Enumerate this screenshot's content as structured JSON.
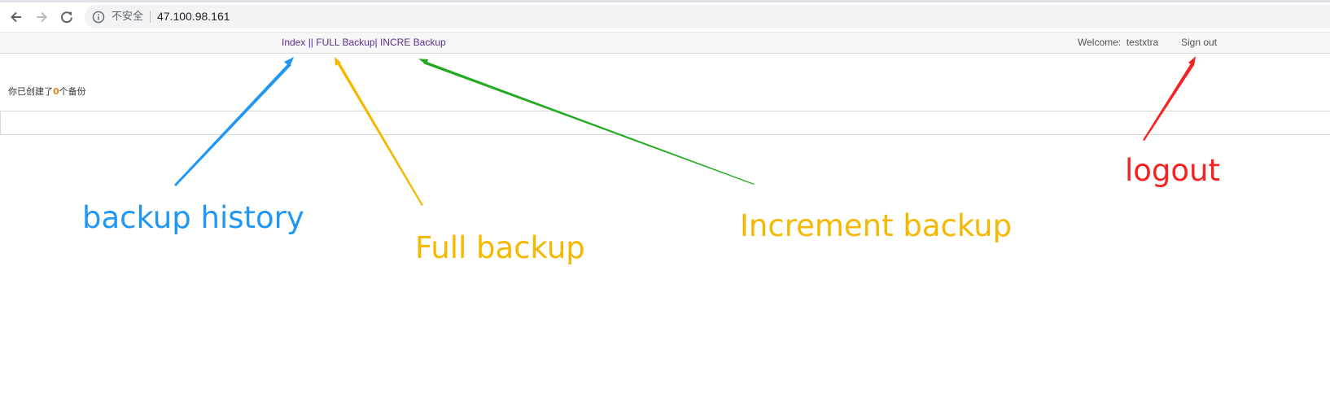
{
  "browser": {
    "security_label": "不安全",
    "url": "47.100.98.161",
    "icons": [
      "back-arrow-icon",
      "forward-arrow-icon",
      "reload-icon",
      "info-icon"
    ]
  },
  "navbar": {
    "links_part1": "Index",
    "links_sep1": " || ",
    "links_part2": "FULL Backup",
    "links_sep2": "| ",
    "links_part3": "INCRE Backup",
    "welcome": "Welcome:  testxtra",
    "signout": "Sign out",
    "link_color": "#5a2f8e"
  },
  "content": {
    "count_prefix": "你已创建了",
    "count_value": "0",
    "count_suffix": "个备份",
    "count_color": "#e8821e"
  },
  "annotations": {
    "backup_history": {
      "text": "backup history",
      "color": "#2196f3"
    },
    "full_backup": {
      "text": "Full backup",
      "color": "#f5b800"
    },
    "increment_backup": {
      "text": "Increment backup",
      "color": "#f5b800"
    },
    "logout": {
      "text": "logout",
      "color": "#f52222"
    },
    "arrow_colors": [
      "#2196f3",
      "#f5b800",
      "#22aa22",
      "#f52222"
    ]
  }
}
